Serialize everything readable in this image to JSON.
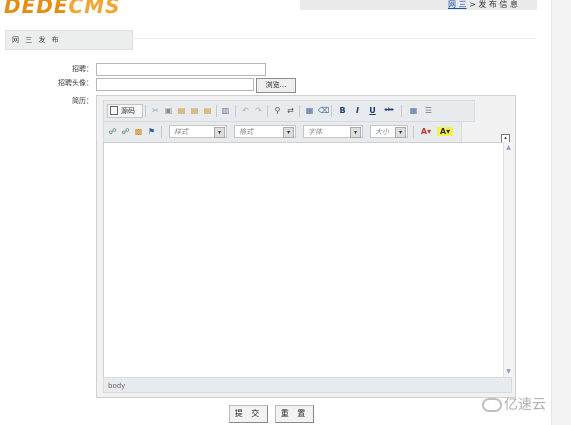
{
  "header": {
    "logo_main": "DEDE",
    "logo_sub": "CMS",
    "breadcrumb_home": "网 三",
    "breadcrumb_sep": ">",
    "breadcrumb_current": "发 布 信 息"
  },
  "tab": {
    "label": "网 三 发 布"
  },
  "form": {
    "field1_label": "招聘：",
    "field2_label": "招聘头像：",
    "field3_label": "简历：",
    "browse_label": "浏览..."
  },
  "editor": {
    "source_label": "源码",
    "combo_style": "样式",
    "combo_format": "格式",
    "combo_font": "字体",
    "combo_size": "大小",
    "status_path": "body"
  },
  "actions": {
    "submit": "提 交",
    "reset": "重 置"
  },
  "watermark": {
    "text": "亿速云"
  }
}
